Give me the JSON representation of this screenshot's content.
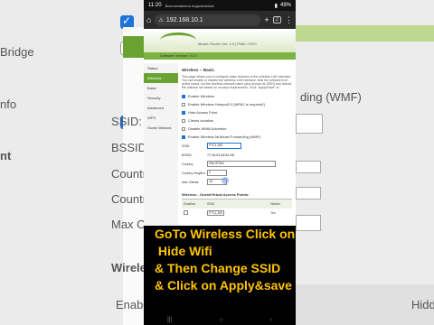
{
  "background_left": {
    "labels": [
      "Bridge",
      "nfo",
      "nt"
    ]
  },
  "background_right": {
    "labels": [
      "SSID:",
      "BSSID:",
      "Countr",
      "Countr",
      "Max C",
      "Wireles",
      "Enabl",
      "Hidden"
    ],
    "wmf_text": "ding (WMF)"
  },
  "statusbar": {
    "time": "11:20",
    "notice": "Восстановлено подключение",
    "battery": "49%"
  },
  "browser": {
    "url": "192.168.10.1",
    "tab_count": "2"
  },
  "router_page": {
    "model_text": "Model: Router Ver. 1.0 | F660 / F670",
    "subheader": "Software Version: V1.0",
    "sidebar_items": [
      "Status",
      "Wireless",
      "Basic",
      "Security",
      "Advanced",
      "WPS",
      "Guest Network"
    ],
    "section_title": "Wireless -- Basic",
    "description": "This page allows you to configure basic features of the wireless LAN interface. You can enable or disable the wireless LAN interface, hide the network from active scans, set the wireless network name (also known as SSID) and restrict the channel set based on country requirements. Click \"Apply/Save\" to configure the basic wireless options.",
    "options": [
      {
        "label": "Enable Wireless",
        "checked": true
      },
      {
        "label": "Enable Wireless Hotspot2.0 [WPA2 is required!]",
        "checked": false
      },
      {
        "label": "Hide Access Point",
        "checked": true
      },
      {
        "label": "Clients Isolation",
        "checked": false
      },
      {
        "label": "Disable WMM Advertise",
        "checked": false
      },
      {
        "label": "Enable Wireless Multicast Forwarding (WMF)",
        "checked": true
      }
    ],
    "ssid_label": "SSID:",
    "ssid_value": "PTCL-BB",
    "bssid_label": "BSSID:",
    "bssid_value": "7C:39:53:A8:5A:3B",
    "country_label": "Country:",
    "country_value": "PAKISTAN",
    "country_region_label": "Country RegRev:",
    "country_region_value": "0",
    "max_clients_label": "Max Clients:",
    "max_clients_value": "16",
    "guest_title": "Wireless - Guest/Virtual Access Points:",
    "guest_headers": [
      "Enabled",
      "SSID",
      "Hidden"
    ],
    "guest_rows": [
      {
        "ssid": "PTCL-BB",
        "hidden": "Yes"
      }
    ]
  },
  "caption": {
    "line1": "GoTo Wireless Click on",
    "line2": " Hide Wifi",
    "line3": "& Then Change SSID",
    "line4": "& Click on Apply&save",
    "color": "#ffc400"
  }
}
